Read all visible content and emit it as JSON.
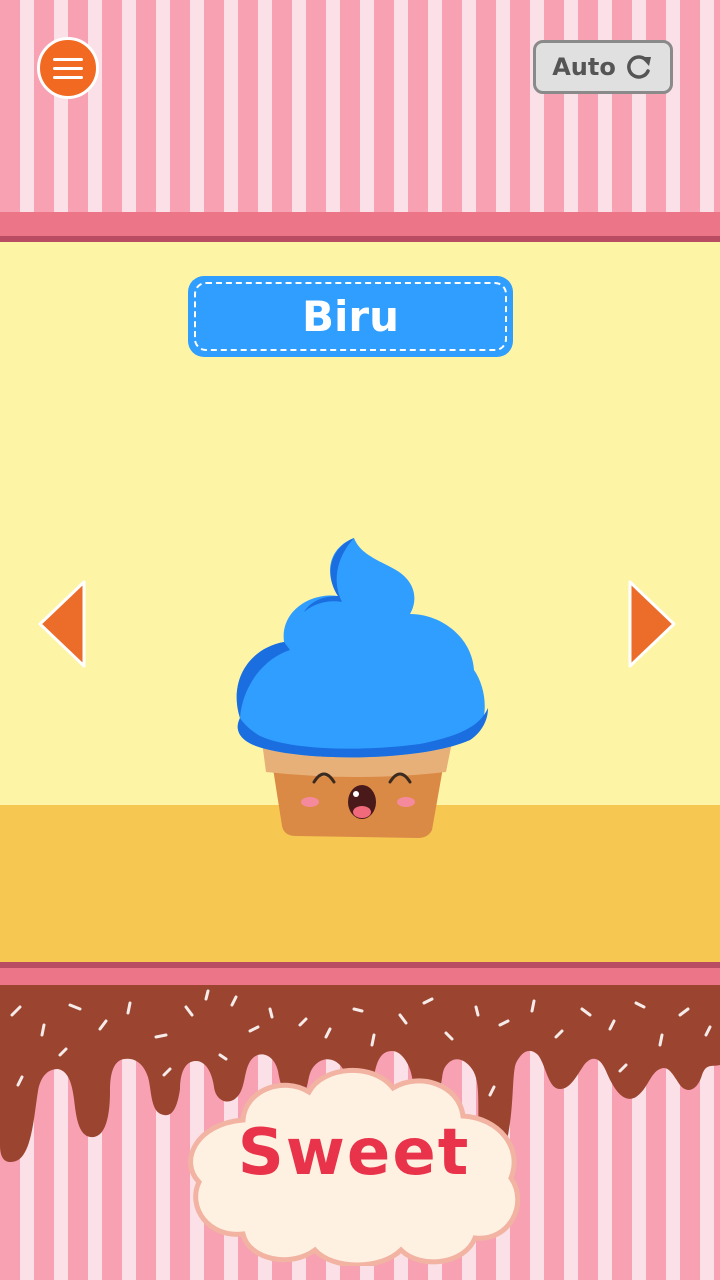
{
  "toolbar": {
    "menu_icon": "hamburger-icon",
    "auto_label": "Auto",
    "auto_icon": "refresh-icon"
  },
  "card": {
    "color_name": "Biru",
    "label_color": "#2f9eff"
  },
  "navigation": {
    "prev_icon": "arrow-left-icon",
    "next_icon": "arrow-right-icon",
    "arrow_color": "#ec6d2a"
  },
  "character": {
    "name": "cupcake",
    "frosting_color": "#2f9eff"
  },
  "footer": {
    "word": "Sweet"
  },
  "colors": {
    "stripe_pink": "#f7a1b3",
    "stripe_light": "#fbe1e7",
    "stage_bg": "#fef4a5",
    "table": "#f6c851",
    "chocolate": "#9b4430",
    "sweet_text": "#e8334a"
  }
}
